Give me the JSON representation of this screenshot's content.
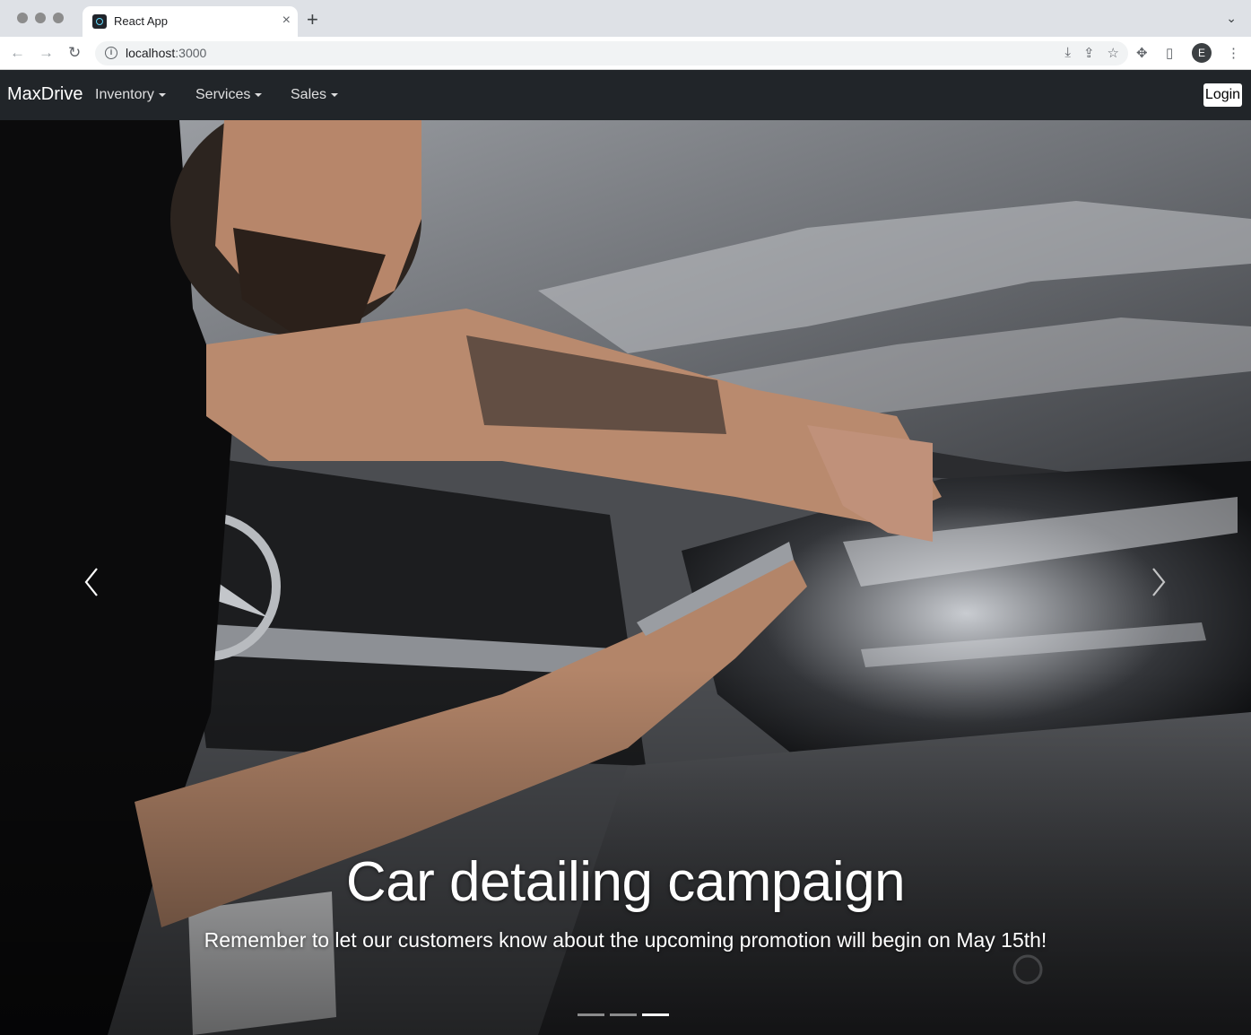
{
  "browser": {
    "tab_title": "React App",
    "tab_close": "×",
    "new_tab": "+",
    "url_host": "localhost",
    "url_port": ":3000",
    "profile_initial": "E"
  },
  "navbar": {
    "brand": "MaxDrive",
    "items": [
      {
        "label": "Inventory"
      },
      {
        "label": "Services"
      },
      {
        "label": "Sales"
      }
    ],
    "login_label": "Login"
  },
  "carousel": {
    "slide_count": 3,
    "active_index": 2,
    "caption_title": "Car detailing campaign",
    "caption_text": "Remember to let our customers know about the upcoming promotion will begin on May 15th!"
  },
  "colors": {
    "navbar_bg": "#212529",
    "tabbar_bg": "#dee1e6"
  }
}
